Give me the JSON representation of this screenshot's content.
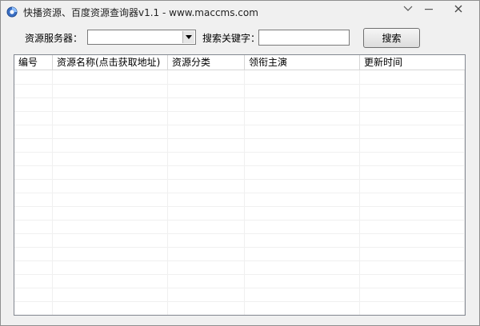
{
  "window": {
    "title": "快播资源、百度资源查询器v1.1 - www.maccms.com"
  },
  "toolbar": {
    "server_label": "资源服务器：",
    "server_value": "",
    "keyword_label": "搜索关键字：",
    "keyword_value": "",
    "search_button": "搜索"
  },
  "table": {
    "columns": [
      {
        "label": "编号"
      },
      {
        "label": "资源名称(点击获取地址)"
      },
      {
        "label": "资源分类"
      },
      {
        "label": "领衔主演"
      },
      {
        "label": "更新时间"
      }
    ],
    "rows": []
  },
  "icons": {
    "app": "app-logo-icon",
    "menu": "chevron-down-icon",
    "minimize": "minimize-icon",
    "close": "close-icon",
    "dropdown": "dropdown-arrow-icon"
  },
  "colors": {
    "window_bg": "#f0f0f0",
    "list_border": "#828790",
    "grid_line": "#f0f0f0"
  }
}
